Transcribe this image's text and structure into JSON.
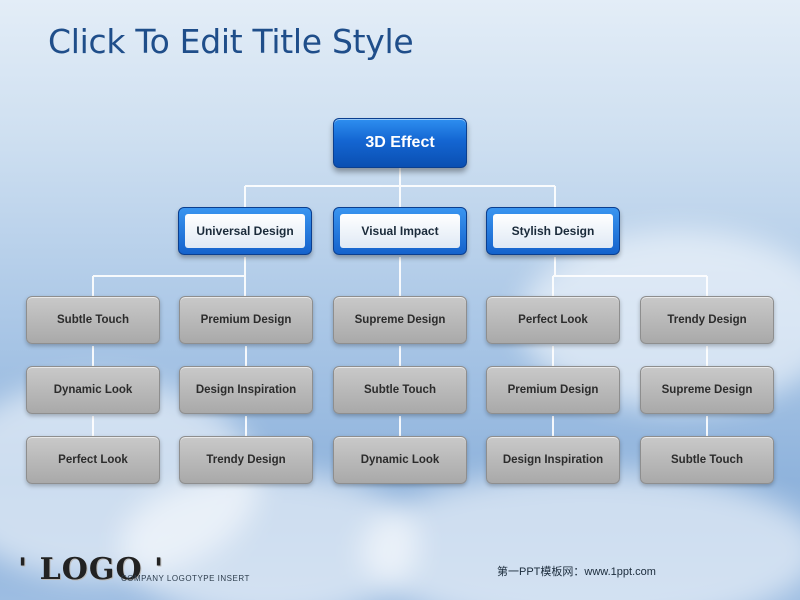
{
  "slide": {
    "title": "Click To Edit Title Style",
    "logo": "' LOGO '",
    "logo_subtitle": "COMPANY LOGOTYPE INSERT",
    "footer_text": "第一PPT模板网：www.1ppt.com"
  },
  "org_chart": {
    "root": "3D Effect",
    "branches": [
      {
        "label": "Universal Design",
        "children": [
          [
            "Subtle Touch",
            "Dynamic Look",
            "Perfect Look"
          ],
          [
            "Premium Design",
            "Design Inspiration",
            "Trendy Design"
          ]
        ]
      },
      {
        "label": "Visual Impact",
        "children": [
          [
            "Supreme Design",
            "Subtle Touch",
            "Dynamic Look"
          ]
        ]
      },
      {
        "label": "Stylish Design",
        "children": [
          [
            "Perfect Look",
            "Premium Design",
            "Design Inspiration"
          ],
          [
            "Trendy Design",
            "Supreme Design",
            "Subtle Touch"
          ]
        ]
      }
    ]
  },
  "colors": {
    "root_fill": "#1466d2",
    "branch_border": "#1462cc",
    "leaf_fill": "#b4b4b4",
    "connector": "#ffffff",
    "title": "#1f4e8a"
  }
}
